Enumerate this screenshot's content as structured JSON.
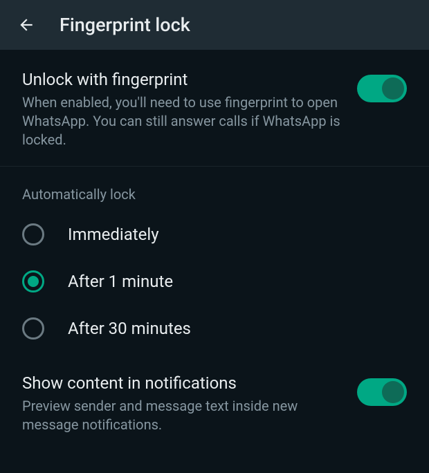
{
  "header": {
    "title": "Fingerprint lock"
  },
  "unlock": {
    "title": "Unlock with fingerprint",
    "desc": "When enabled, you'll need to use fingerprint to open WhatsApp. You can still answer calls if WhatsApp is locked.",
    "enabled": true
  },
  "autoLock": {
    "header": "Automatically lock",
    "options": [
      {
        "label": "Immediately",
        "selected": false
      },
      {
        "label": "After 1 minute",
        "selected": true
      },
      {
        "label": "After 30 minutes",
        "selected": false
      }
    ]
  },
  "notifications": {
    "title": "Show content in notifications",
    "desc": "Preview sender and message text inside new message notifications.",
    "enabled": true
  }
}
